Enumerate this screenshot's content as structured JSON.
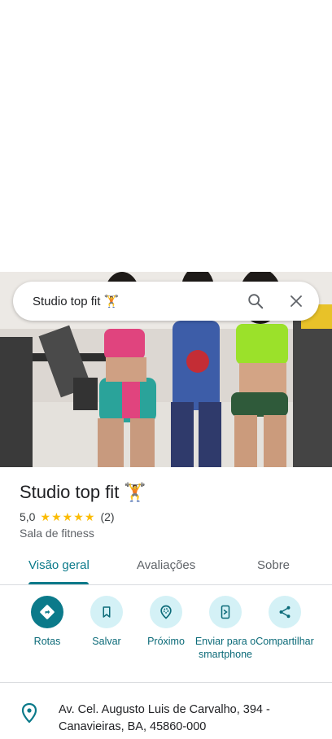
{
  "search": {
    "query": "Studio top fit 🏋",
    "search_icon": "search-icon",
    "close_icon": "close-icon"
  },
  "place": {
    "title": "Studio top fit 🏋",
    "rating": "5,0",
    "stars": 5,
    "review_count": "(2)",
    "category": "Sala de fitness"
  },
  "tabs": [
    {
      "label": "Visão geral",
      "active": true
    },
    {
      "label": "Avaliações",
      "active": false
    },
    {
      "label": "Sobre",
      "active": false
    }
  ],
  "actions": [
    {
      "label": "Rotas",
      "icon": "directions-icon"
    },
    {
      "label": "Salvar",
      "icon": "bookmark-icon"
    },
    {
      "label": "Próximo",
      "icon": "nearby-icon"
    },
    {
      "label": "Enviar para o smartphone",
      "icon": "send-to-phone-icon"
    },
    {
      "label": "Compartilhar",
      "icon": "share-icon"
    }
  ],
  "address": {
    "line1": "Av. Cel. Augusto Luis de Carvalho, 394 -",
    "line2": "Canavieiras, BA, 45860-000",
    "icon": "location-pin-icon"
  },
  "colors": {
    "accent": "#0b7a8a",
    "action_bg": "#d4f1f6",
    "star": "#fbbc04"
  }
}
